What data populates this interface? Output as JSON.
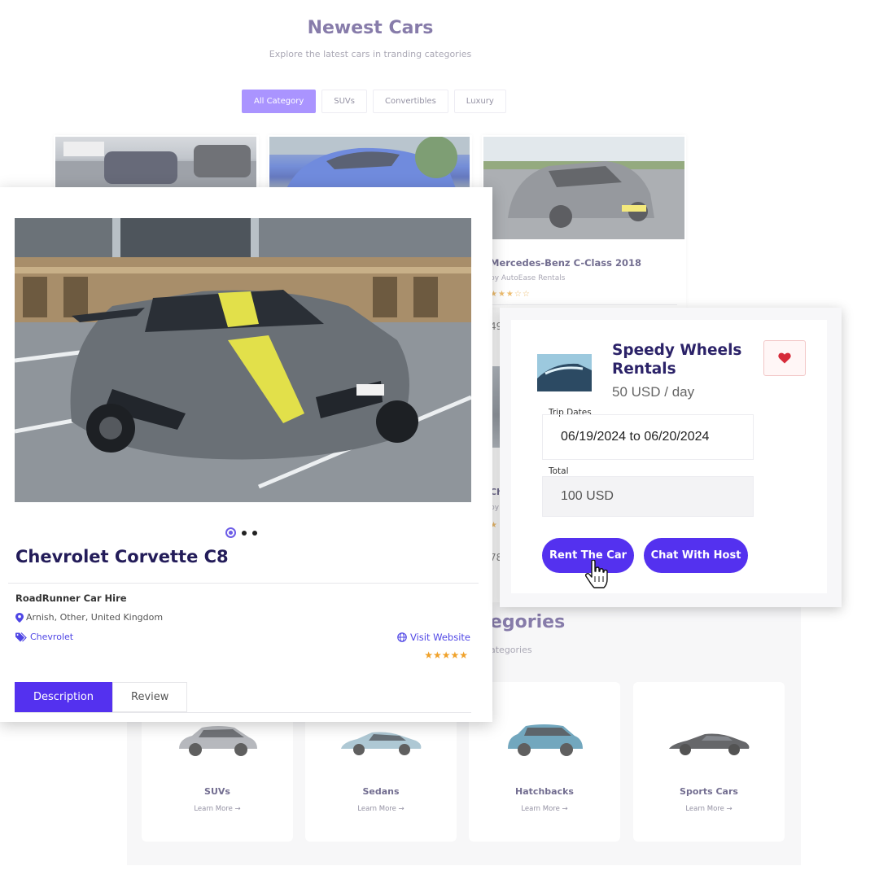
{
  "newest": {
    "title": "Newest Cars",
    "subtitle": "Explore the latest cars in tranding categories",
    "filters": [
      "All Category",
      "SUVs",
      "Convertibles",
      "Luxury"
    ]
  },
  "listing_cards": {
    "mercedes_title": "Mercedes-Benz C-Class 2018",
    "mercedes_by": "by AutoEase Rentals",
    "mercedes_stars": "★★★☆☆",
    "fragment_49": "49",
    "fragment_ch": "Ch",
    "fragment_by": "by I",
    "fragment_78": "78"
  },
  "categories": {
    "title_fragment": "egories",
    "subtitle_fragment": "ategories",
    "items": [
      {
        "name": "SUVs",
        "link": "Learn More →"
      },
      {
        "name": "Sedans",
        "link": "Learn More →"
      },
      {
        "name": "Hatchbacks",
        "link": "Learn More →"
      },
      {
        "name": "Sports Cars",
        "link": "Learn More →"
      }
    ]
  },
  "detail": {
    "title": "Chevrolet Corvette C8",
    "host": "RoadRunner Car Hire",
    "location": "Arnish, Other, United Kingdom",
    "brand": "Chevrolet",
    "website": "Visit Website",
    "rating": "★★★★★",
    "rating_value": 5,
    "tabs": [
      "Description",
      "Review"
    ],
    "gallery_count": 3,
    "gallery_active": 0
  },
  "booking": {
    "host_name": "Speedy Wheels Rentals",
    "price": "50 USD / day",
    "trip_label": "Trip Dates",
    "trip_value": "06/19/2024 to 06/20/2024",
    "total_label": "Total",
    "total_value": "100 USD",
    "rent_button": "Rent The Car",
    "chat_button": "Chat With Host"
  },
  "colors": {
    "accent": "#5431ef",
    "filter_active": "#8a6cff",
    "heading": "#231c59",
    "star": "#f0a22b",
    "heart": "#d62b3a"
  },
  "icons": [
    "map-pin-icon",
    "tag-icon",
    "globe-icon",
    "heart-icon",
    "hand-cursor-icon"
  ]
}
